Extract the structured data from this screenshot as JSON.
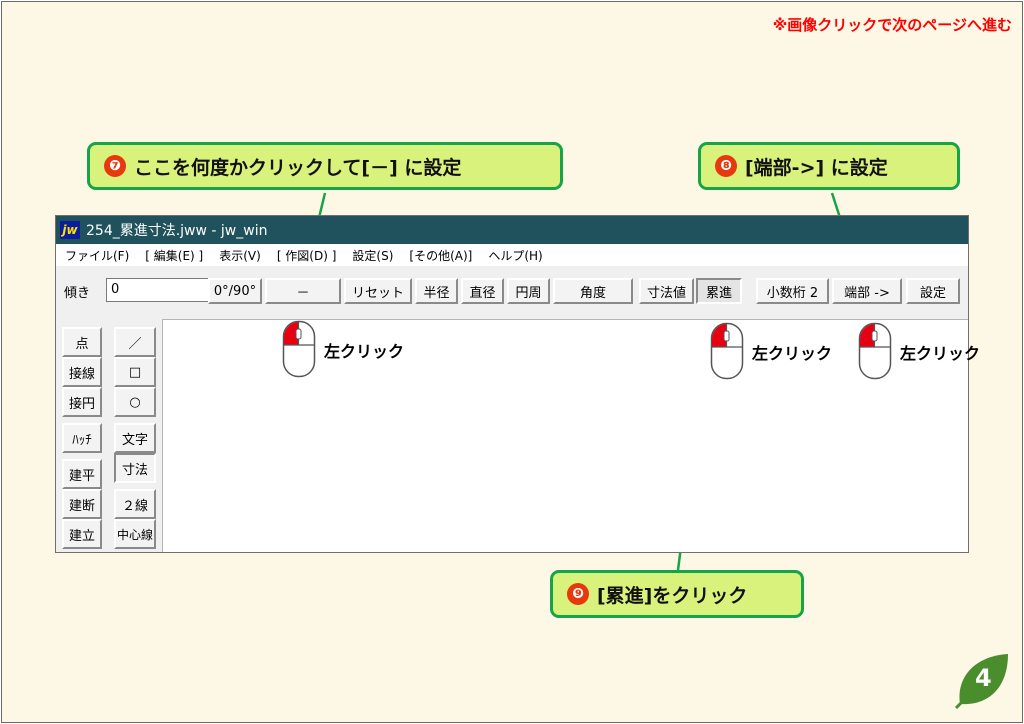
{
  "slide": {
    "note": "※画像クリックで次のページへ進む",
    "page_number": "4"
  },
  "callouts": [
    {
      "number": "❼",
      "text": "ここを何度かクリックして[－] に設定"
    },
    {
      "number": "❽",
      "text": "[端部->] に設定"
    },
    {
      "number": "❾",
      "text": "[累進]をクリック"
    }
  ],
  "click_label": "左クリック",
  "window": {
    "icon_text": "jw",
    "title": "254_累進寸法.jww - jw_win"
  },
  "menu": [
    "ファイル(F)",
    "[ 編集(E) ]",
    "表示(V)",
    "[ 作図(D) ]",
    "設定(S)",
    "[その他(A)]",
    "ヘルプ(H)"
  ],
  "toolbar": {
    "tilt_label": "傾き",
    "tilt_value": "0",
    "buttons": [
      "0°/90°",
      "－",
      "リセット",
      "半径",
      "直径",
      "円周",
      "角度",
      "寸法値",
      "累進",
      "小数桁 2",
      "端部 ->",
      "設定"
    ]
  },
  "left_tools": {
    "col1": [
      "点",
      "接線",
      "接円",
      "ﾊｯﾁ",
      "建平",
      "建断",
      "建立"
    ],
    "col2": [
      "／",
      "□",
      "○",
      "文字",
      "寸法",
      "２線",
      "中心線"
    ]
  },
  "colors": {
    "callout_fill": "#d9f27c",
    "callout_border": "#16a34a",
    "note_red": "#ff0000",
    "title_bar": "#1f525c",
    "mouse_red": "#e60012"
  }
}
